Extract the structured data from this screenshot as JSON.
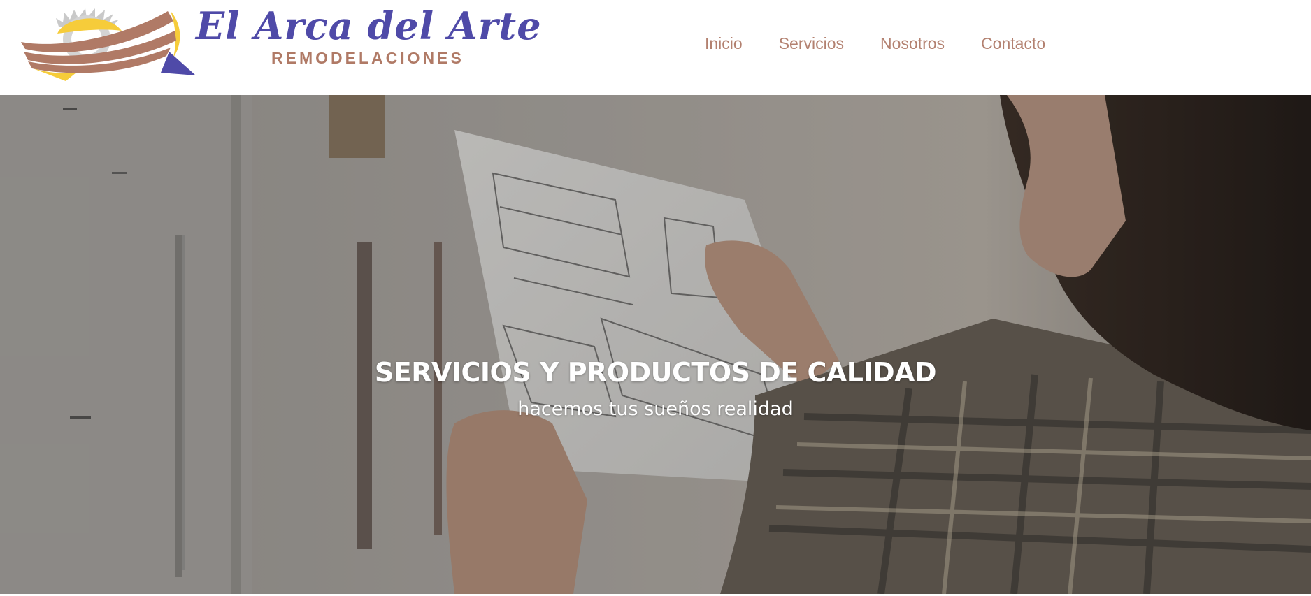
{
  "colors": {
    "brand_purple": "#4f4aa8",
    "brand_terracotta": "#b07a66",
    "brand_yellow": "#f6cc3a",
    "nav_text": "#b38170",
    "hero_text": "#ffffff"
  },
  "logo": {
    "title": "El Arca del Arte",
    "subtitle": "REMODELACIONES",
    "icon": "ark-saw-logo-icon"
  },
  "nav": {
    "items": [
      {
        "label": "Inicio"
      },
      {
        "label": "Servicios"
      },
      {
        "label": "Nosotros"
      },
      {
        "label": "Contacto"
      }
    ]
  },
  "hero": {
    "title": "SERVICIOS Y PRODUCTOS DE CALIDAD",
    "subtitle": "hacemos tus sueños realidad",
    "image": "carpenter-holding-blueprint-photo"
  }
}
